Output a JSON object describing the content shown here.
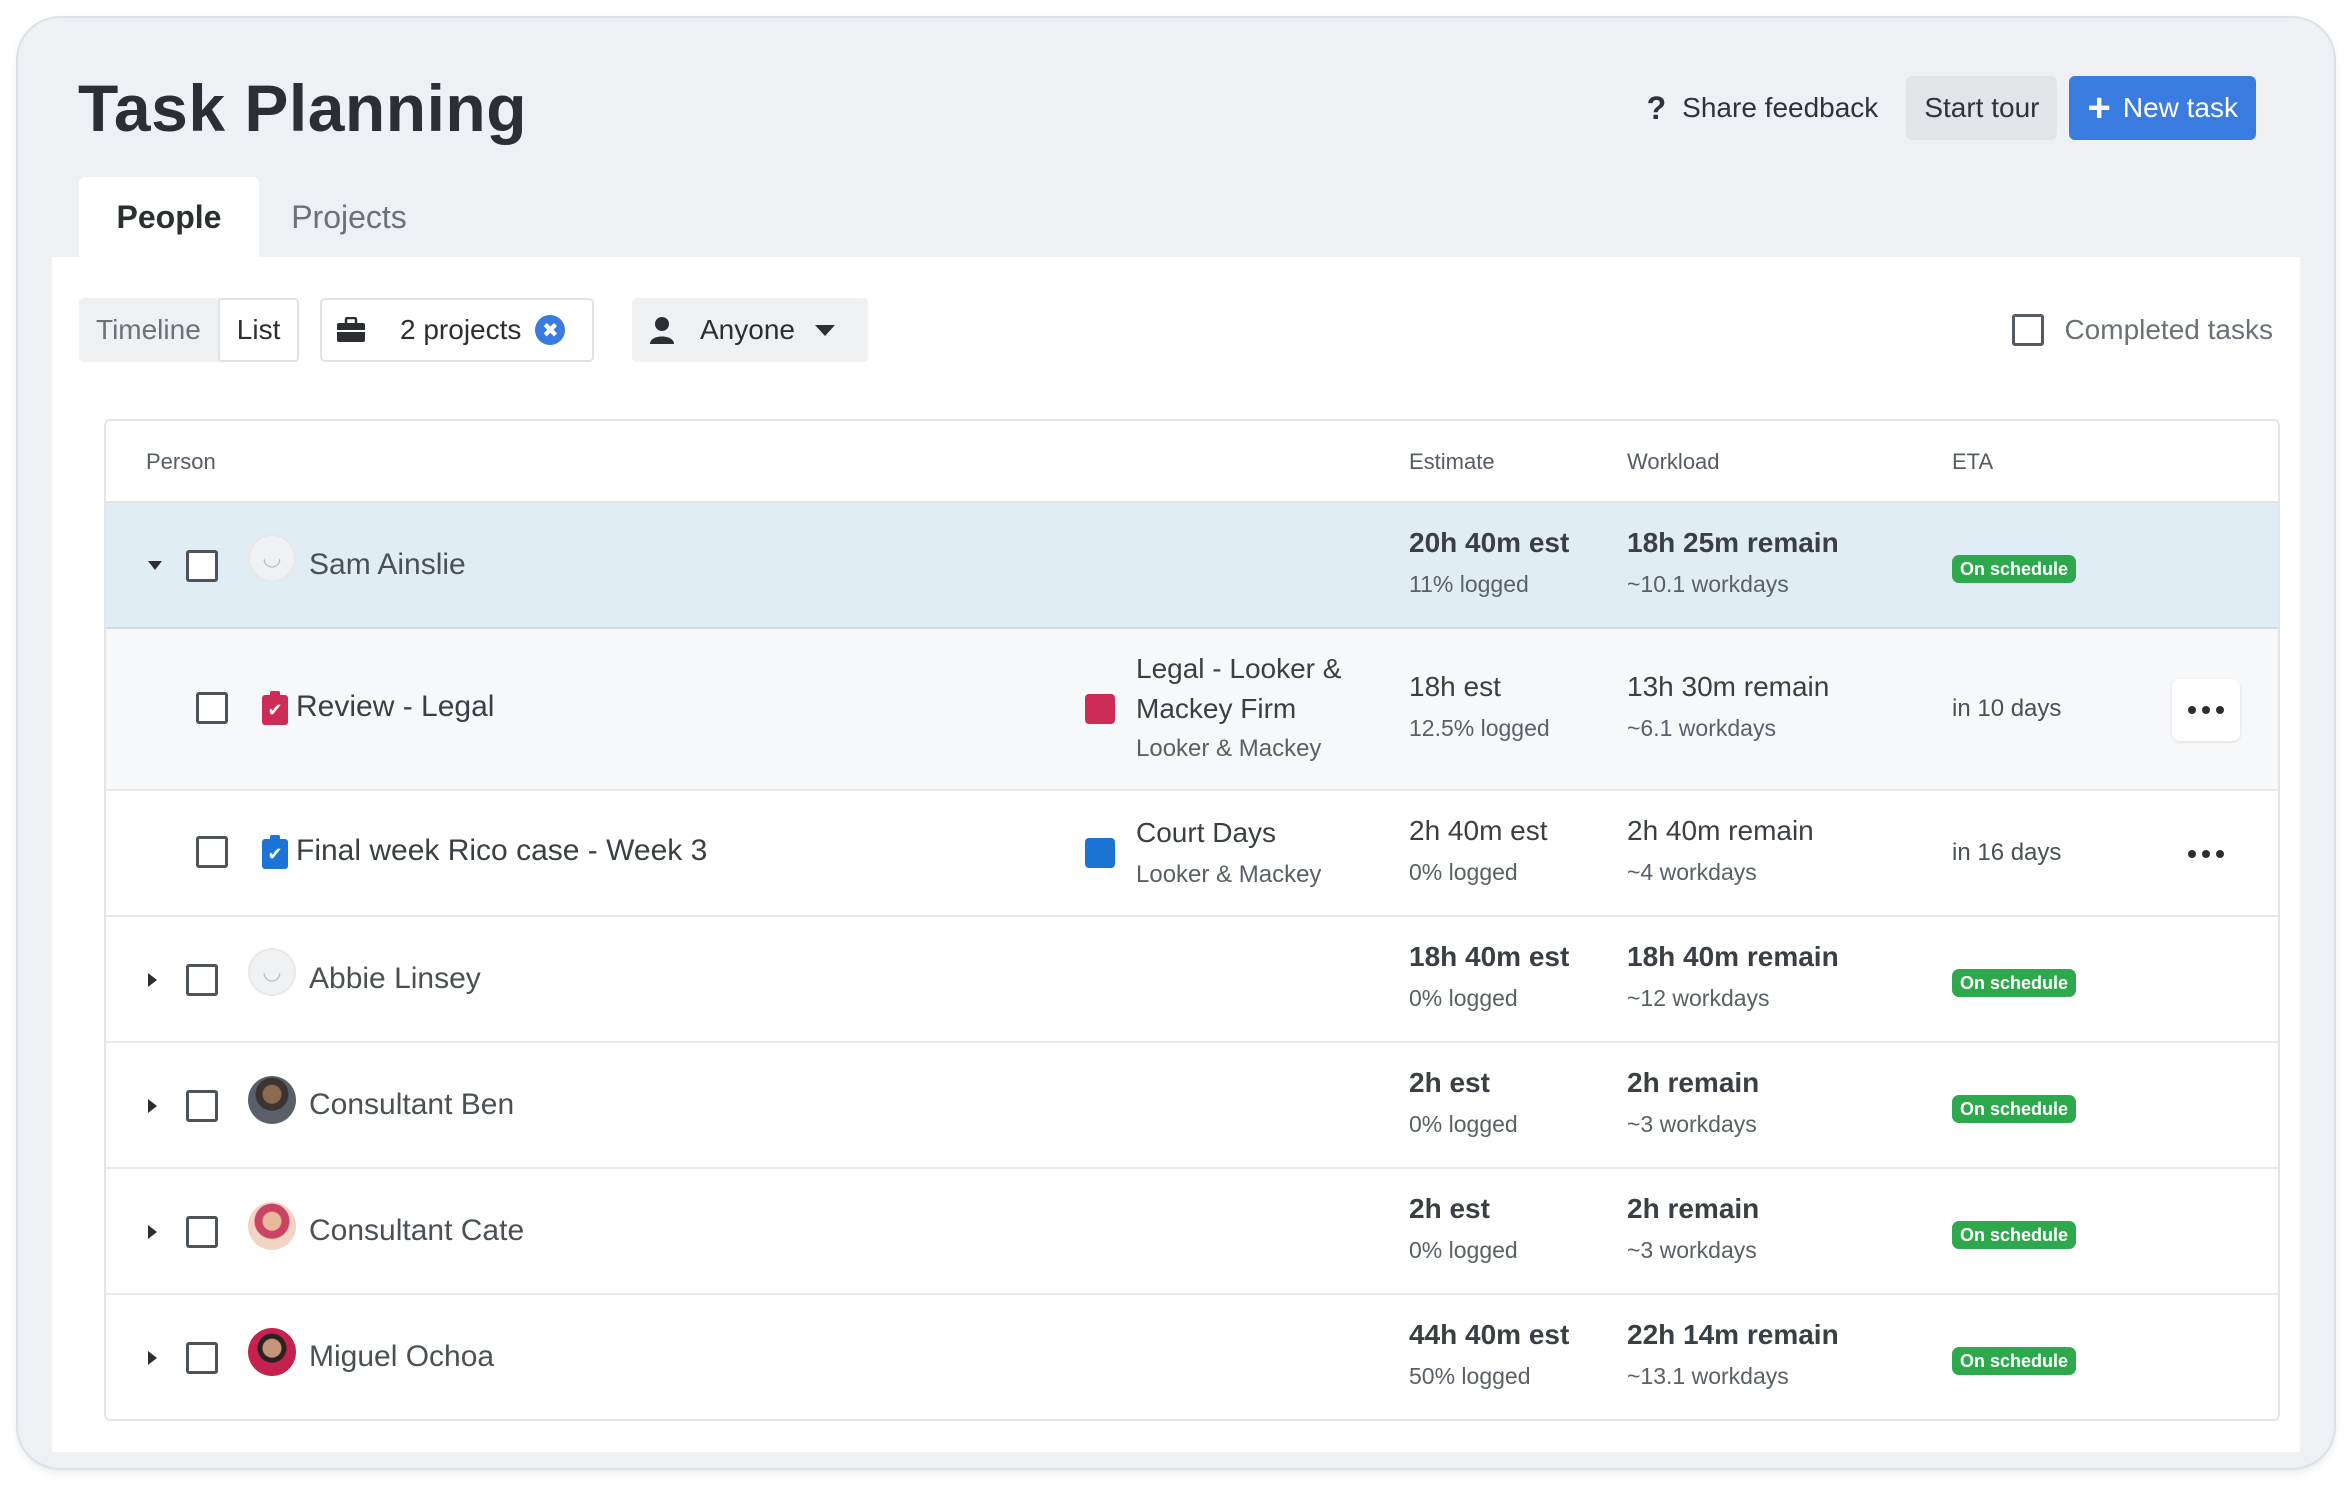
{
  "header": {
    "title": "Task Planning",
    "feedback_icon": "?",
    "feedback_label": "Share feedback",
    "tour_label": "Start tour",
    "new_task_icon": "+",
    "new_task_label": "New task"
  },
  "tabs": [
    {
      "label": "People",
      "active": true
    },
    {
      "label": "Projects",
      "active": false
    }
  ],
  "toolbar": {
    "view_options": [
      "Timeline",
      "List"
    ],
    "selected_view": "List",
    "projects_filter": "2 projects",
    "projects_clear_icon": "✖",
    "person_filter": "Anyone",
    "completed_tasks_label": "Completed tasks"
  },
  "table": {
    "columns": {
      "person": "Person",
      "estimate": "Estimate",
      "workload": "Workload",
      "eta": "ETA"
    },
    "rows": [
      {
        "name": "Sam Ainslie",
        "estimate": "20h 40m est",
        "logged": "11% logged",
        "remain": "18h 25m remain",
        "workdays": "~10.1 workdays",
        "eta": "On schedule"
      },
      {
        "task": "Review - Legal",
        "project": "Legal - Looker & Mackey Firm",
        "client": "Looker & Mackey",
        "estimate": "18h est",
        "logged": "12.5% logged",
        "remain": "13h 30m remain",
        "workdays": "~6.1 workdays",
        "eta": "in 10 days"
      },
      {
        "task": "Final week Rico case - Week 3",
        "project": "Court Days",
        "client": "Looker & Mackey",
        "estimate": "2h 40m est",
        "logged": "0% logged",
        "remain": "2h 40m remain",
        "workdays": "~4 workdays",
        "eta": "in 16 days"
      },
      {
        "name": "Abbie Linsey",
        "estimate": "18h 40m est",
        "logged": "0% logged",
        "remain": "18h 40m remain",
        "workdays": "~12 workdays",
        "eta": "On schedule"
      },
      {
        "name": "Consultant Ben",
        "estimate": "2h est",
        "logged": "0% logged",
        "remain": "2h remain",
        "workdays": "~3 workdays",
        "eta": "On schedule"
      },
      {
        "name": "Consultant Cate",
        "estimate": "2h est",
        "logged": "0% logged",
        "remain": "2h remain",
        "workdays": "~3 workdays",
        "eta": "On schedule"
      },
      {
        "name": "Miguel Ochoa",
        "estimate": "44h 40m est",
        "logged": "50% logged",
        "remain": "22h 14m remain",
        "workdays": "~13.1 workdays",
        "eta": "On schedule"
      }
    ]
  },
  "colors": {
    "accent": "#3a7be0",
    "on_schedule": "#2ea84d",
    "project_legal": "#cc2c55",
    "project_court": "#1c74d4",
    "selected_row": "#e1edf5"
  }
}
